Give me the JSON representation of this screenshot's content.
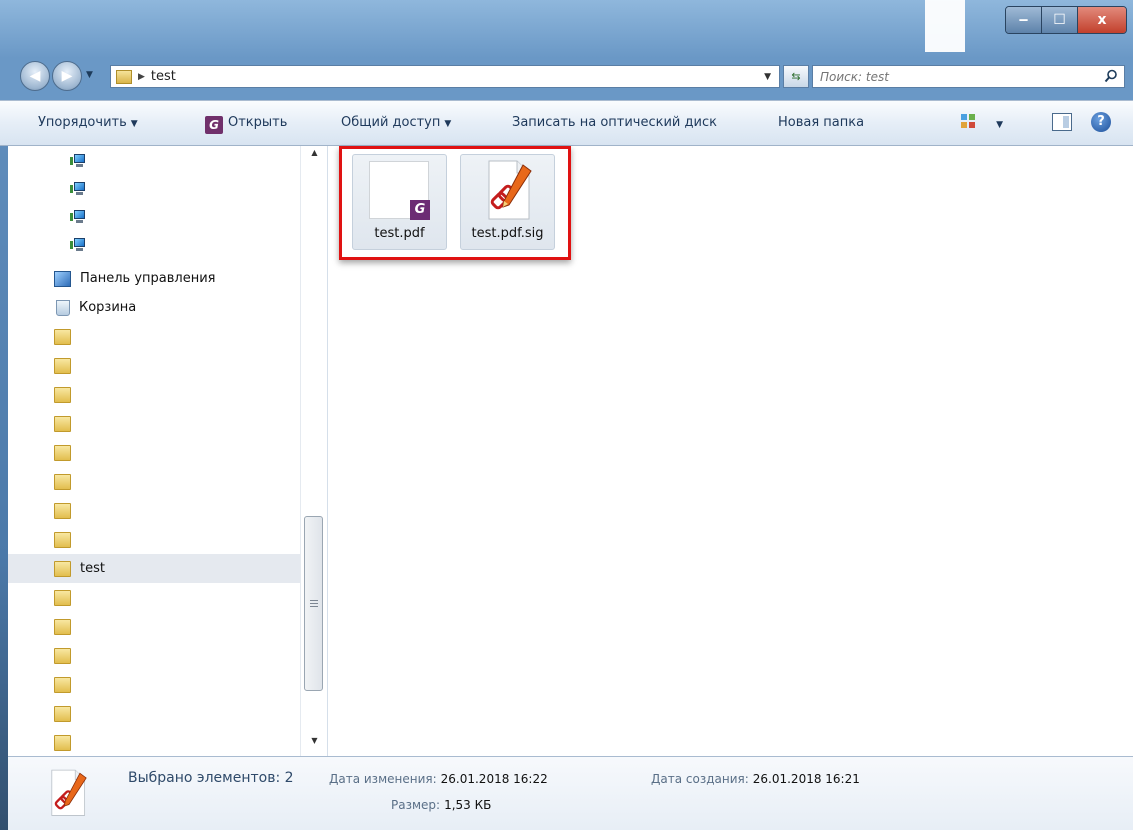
{
  "window": {
    "caption_buttons": [
      "‒",
      "☐",
      "x"
    ]
  },
  "address": {
    "path": "test",
    "search_placeholder": "Поиск: test"
  },
  "toolbar": {
    "organize": "Упорядочить",
    "open": "Открыть",
    "share": "Общий доступ",
    "burn": "Записать на оптический диск",
    "new_folder": "Новая папка"
  },
  "nav": {
    "items": [
      {
        "type": "computer",
        "label": ""
      },
      {
        "type": "computer",
        "label": ""
      },
      {
        "type": "computer",
        "label": ""
      },
      {
        "type": "computer",
        "label": ""
      },
      {
        "type": "control-panel",
        "label": "Панель управления"
      },
      {
        "type": "recycle-bin",
        "label": "Корзина"
      },
      {
        "type": "folder",
        "label": ""
      },
      {
        "type": "folder",
        "label": ""
      },
      {
        "type": "folder",
        "label": ""
      },
      {
        "type": "folder",
        "label": ""
      },
      {
        "type": "folder",
        "label": ""
      },
      {
        "type": "folder",
        "label": ""
      },
      {
        "type": "folder",
        "label": ""
      },
      {
        "type": "folder",
        "label": ""
      },
      {
        "type": "folder",
        "label": "test",
        "selected": true
      },
      {
        "type": "folder",
        "label": ""
      },
      {
        "type": "folder",
        "label": ""
      },
      {
        "type": "folder",
        "label": ""
      },
      {
        "type": "folder",
        "label": ""
      },
      {
        "type": "folder",
        "label": ""
      },
      {
        "type": "folder",
        "label": ""
      }
    ]
  },
  "files": [
    {
      "name": "test.pdf",
      "icon": "pdf-file-icon"
    },
    {
      "name": "test.pdf.sig",
      "icon": "signature-file-icon"
    }
  ],
  "details": {
    "selected": "Выбрано элементов: 2",
    "modified_label": "Дата изменения:",
    "modified_value": "26.01.2018 16:22",
    "created_label": "Дата создания:",
    "created_value": "26.01.2018 16:21",
    "size_label": "Размер:",
    "size_value": "1,53 КБ"
  },
  "colors": {
    "highlight": "#e01212",
    "selection": "#e5e9ef",
    "pdf_badge": "#6c2c74"
  }
}
